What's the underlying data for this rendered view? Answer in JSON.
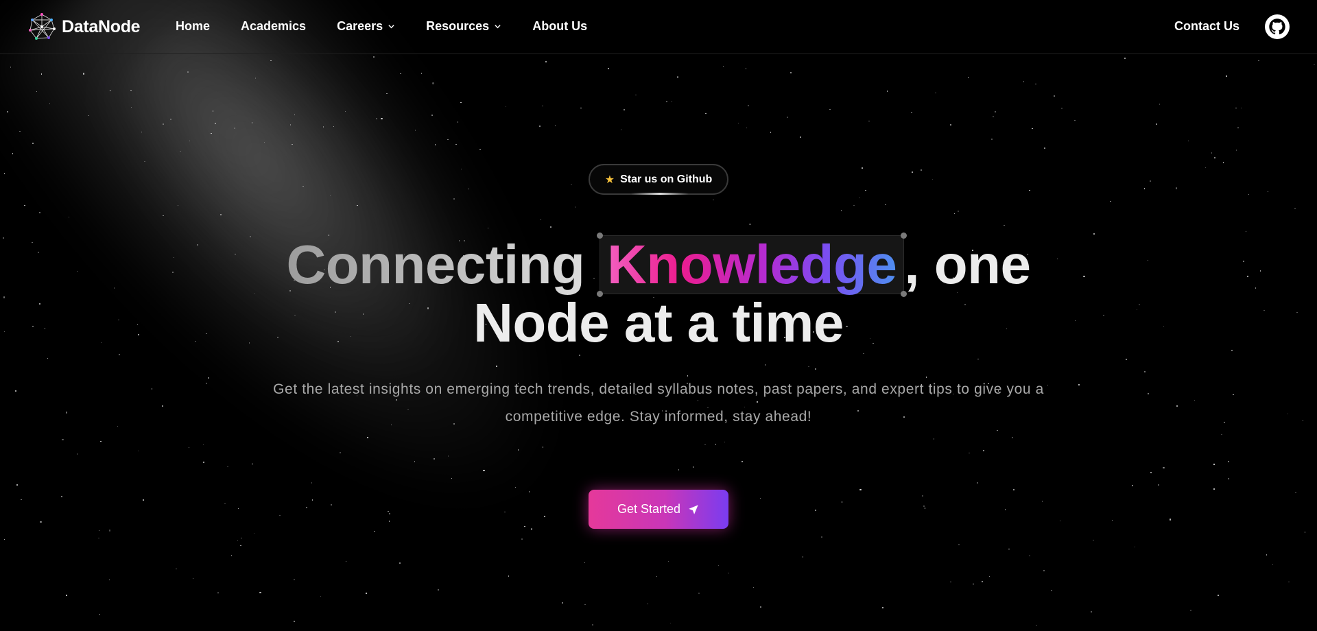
{
  "brand": {
    "name": "DataNode",
    "logo_icon": "network-globe-logo-icon"
  },
  "nav": {
    "items": [
      {
        "label": "Home",
        "dropdown": false
      },
      {
        "label": "Academics",
        "dropdown": false
      },
      {
        "label": "Careers",
        "dropdown": true
      },
      {
        "label": "Resources",
        "dropdown": true
      },
      {
        "label": "About Us",
        "dropdown": false
      }
    ],
    "contact_label": "Contact Us",
    "github_icon": "github-icon"
  },
  "hero": {
    "badge_label": "Star us on Github",
    "badge_icon": "star-icon",
    "headline": {
      "part1": "Connecting",
      "highlight": "Knowledge",
      "part2": ", one",
      "line2": "Node at a time"
    },
    "subtitle": "Get the latest insights on emerging tech trends, detailed syllabus notes, past papers, and expert tips to give you a competitive edge. Stay informed, stay ahead!",
    "cta_label": "Get Started",
    "cta_icon": "send-arrow-icon"
  },
  "colors": {
    "background": "#000000",
    "accent_pink": "#e5399a",
    "accent_purple": "#7a3cf0",
    "accent_blue": "#4f8ef0",
    "star_yellow": "#f7c23c"
  }
}
